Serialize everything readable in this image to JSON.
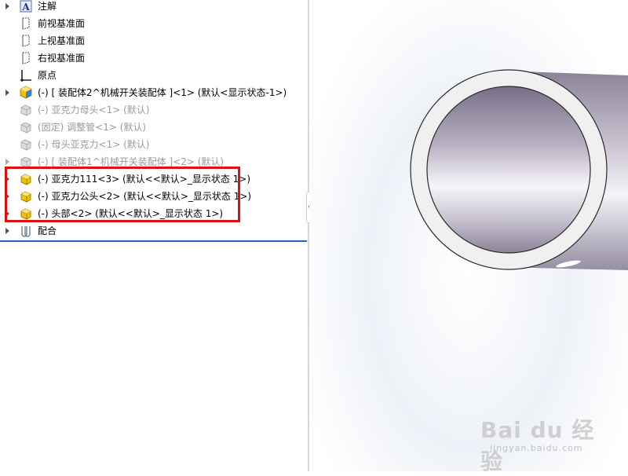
{
  "tree": {
    "items": [
      {
        "label": "注解",
        "icon": "annotation-icon",
        "grey": false
      },
      {
        "label": "前视基准面",
        "icon": "plane-icon",
        "grey": false
      },
      {
        "label": "上视基准面",
        "icon": "plane-icon",
        "grey": false
      },
      {
        "label": "右视基准面",
        "icon": "plane-icon",
        "grey": false
      },
      {
        "label": "原点",
        "icon": "origin-icon",
        "grey": false
      },
      {
        "label": "(-) [ 装配体2^机械开关装配体 ]<1> (默认<显示状态-1>)",
        "icon": "subassembly-icon",
        "grey": false
      },
      {
        "label": "(-) 亚克力母头<1> (默认)",
        "icon": "part-suppressed-icon",
        "grey": true
      },
      {
        "label": "(固定) 调整管<1> (默认)",
        "icon": "part-suppressed-icon",
        "grey": true
      },
      {
        "label": "(-) 母头亚克力<1> (默认)",
        "icon": "part-suppressed-icon",
        "grey": true
      },
      {
        "label": "(-) [ 装配体1^机械开关装配体 ]<2> (默认)",
        "icon": "subassembly-suppressed-icon",
        "grey": true
      },
      {
        "label": "(-) 亚克力111<3> (默认<<默认>_显示状态 1>)",
        "icon": "part-icon",
        "grey": false
      },
      {
        "label": "(-) 亚克力公头<2> (默认<<默认>_显示状态 1>)",
        "icon": "part-icon",
        "grey": false
      },
      {
        "label": "(-) 头部<2> (默认<<默认>_显示状态 1>)",
        "icon": "part-icon",
        "grey": false
      },
      {
        "label": "配合",
        "icon": "mates-icon",
        "grey": false
      }
    ]
  },
  "colors": {
    "highlight": "#e01010",
    "part_yellow": "#f2c200",
    "assembly_blue": "#3b7fd0"
  },
  "watermark": {
    "brand": "Bai du 经验",
    "url": "jingyan.baidu.com"
  }
}
